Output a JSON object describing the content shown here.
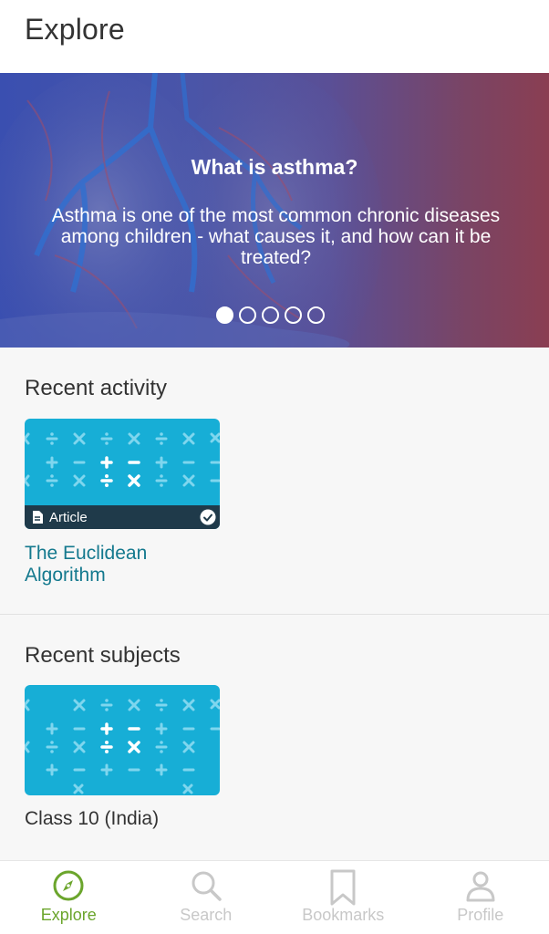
{
  "header": {
    "title": "Explore"
  },
  "hero": {
    "title": "What is asthma?",
    "description": "Asthma is one of the most common chronic diseases among children - what causes it, and how can it be treated?",
    "slide_count": 5,
    "active_slide": 1
  },
  "recent_activity": {
    "title": "Recent activity",
    "item": {
      "type_label": "Article",
      "title": "The Euclidean Algorithm",
      "completed": true,
      "thumbnail_icon": "math-symbols-pattern"
    }
  },
  "recent_subjects": {
    "title": "Recent subjects",
    "item": {
      "label": "Class 10 (India)",
      "thumbnail_icon": "math-symbols-pattern"
    }
  },
  "bottom_nav": {
    "items": [
      {
        "label": "Explore",
        "icon": "compass-icon",
        "active": true
      },
      {
        "label": "Search",
        "icon": "search-icon",
        "active": false
      },
      {
        "label": "Bookmarks",
        "icon": "bookmark-icon",
        "active": false
      },
      {
        "label": "Profile",
        "icon": "profile-icon",
        "active": false
      }
    ]
  },
  "colors": {
    "accent_green": "#6ba52c",
    "link_teal": "#14798e",
    "thumbnail_blue": "#17aed6",
    "hero_left": "#3a4fb0",
    "hero_right": "#8a3e52"
  }
}
